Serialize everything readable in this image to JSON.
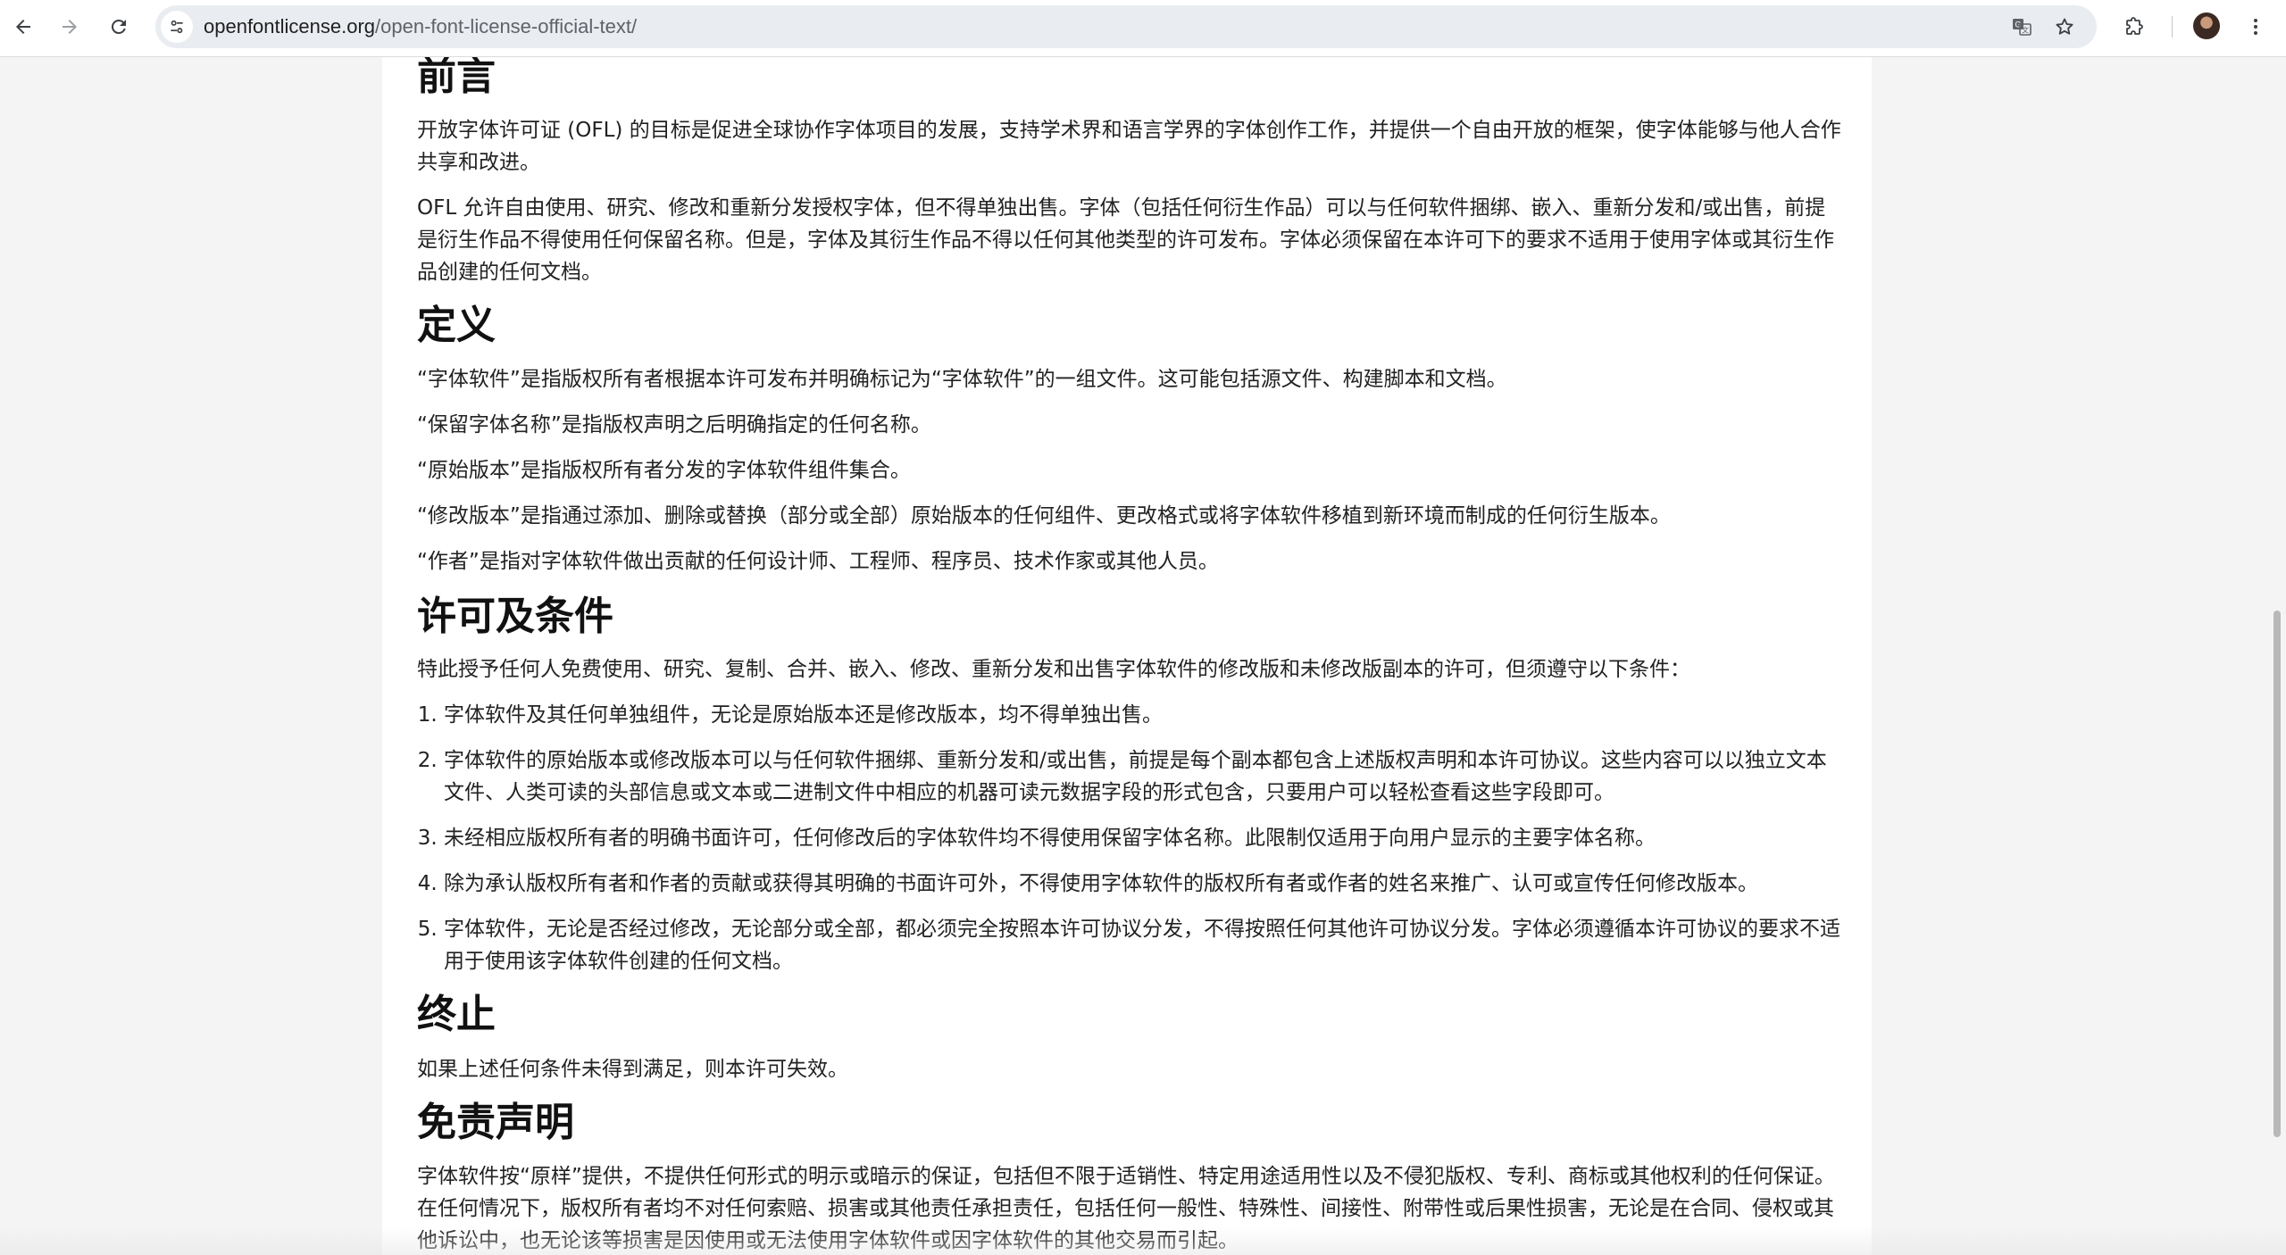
{
  "browser": {
    "url_domain": "openfontlicense.org",
    "url_path": "/open-font-license-official-text/",
    "icons": {
      "back": "arrow-left-icon",
      "forward": "arrow-right-icon",
      "reload": "reload-icon",
      "site_info": "tune-icon",
      "translate": "translate-icon",
      "bookmark": "star-icon",
      "extensions": "puzzle-icon",
      "menu": "kebab-menu-icon"
    }
  },
  "sections": {
    "preamble": {
      "heading": "前言",
      "p1": "开放字体许可证 (OFL) 的目标是促进全球协作字体项目的发展，支持学术界和语言学界的字体创作工作，并提供一个自由开放的框架，使字体能够与他人合作共享和改进。",
      "p2": "OFL 允许自由使用、研究、修改和重新分发授权字体，但不得单独出售。字体（包括任何衍生作品）可以与任何软件捆绑、嵌入、重新分发和/或出售，前提是衍生作品不得使用任何保留名称。但是，字体及其衍生作品不得以任何其他类型的许可发布。字体必须保留在本许可下的要求不适用于使用字体或其衍生作品创建的任何文档。"
    },
    "definitions": {
      "heading": "定义",
      "items": [
        "“字体软件”是指版权所有者根据本许可发布并明确标记为“字体软件”的一组文件。这可能包括源文件、构建脚本和文档。",
        "“保留字体名称”是指版权声明之后明确指定的任何名称。",
        "“原始版本”是指版权所有者分发的字体软件组件集合。",
        "“修改版本”是指通过添加、删除或替换（部分或全部）原始版本的任何组件、更改格式或将字体软件移植到新环境而制成的任何衍生版本。",
        "“作者”是指对字体软件做出贡献的任何设计师、工程师、程序员、技术作家或其他人员。"
      ]
    },
    "permission": {
      "heading": "许可及条件",
      "intro": "特此授予任何人免费使用、研究、复制、合并、嵌入、修改、重新分发和出售字体软件的修改版和未修改版副本的许可，但须遵守以下条件：",
      "conditions": [
        "字体软件及其任何单独组件，无论是原始版本还是修改版本，均不得单独出售。",
        "字体软件的原始版本或修改版本可以与任何软件捆绑、重新分发和/或出售，前提是每个副本都包含上述版权声明和本许可协议。这些内容可以以独立文本文件、人类可读的头部信息或文本或二进制文件中相应的机器可读元数据字段的形式包含，只要用户可以轻松查看这些字段即可。",
        "未经相应版权所有者的明确书面许可，任何修改后的字体软件均不得使用保留字体名称。此限制仅适用于向用户显示的主要字体名称。",
        "除为承认版权所有者和作者的贡献或获得其明确的书面许可外，不得使用字体软件的版权所有者或作者的姓名来推广、认可或宣传任何修改版本。",
        "字体软件，无论是否经过修改，无论部分或全部，都必须完全按照本许可协议分发，不得按照任何其他许可协议分发。字体必须遵循本许可协议的要求不适用于使用该字体软件创建的任何文档。"
      ]
    },
    "termination": {
      "heading": "终止",
      "p1": "如果上述任何条件未得到满足，则本许可失效。"
    },
    "disclaimer": {
      "heading": "免责声明",
      "p1": "字体软件按“原样”提供，不提供任何形式的明示或暗示的保证，包括但不限于适销性、特定用途适用性以及不侵犯版权、专利、商标或其他权利的任何保证。在任何情况下，版权所有者均不对任何索赔、损害或其他责任承担责任，包括任何一般性、特殊性、间接性、附带性或后果性损害，无论是在合同、侵权或其他诉讼中，也无论该等损害是因使用或无法使用字体软件或因字体软件的其他交易而引起。"
    }
  }
}
